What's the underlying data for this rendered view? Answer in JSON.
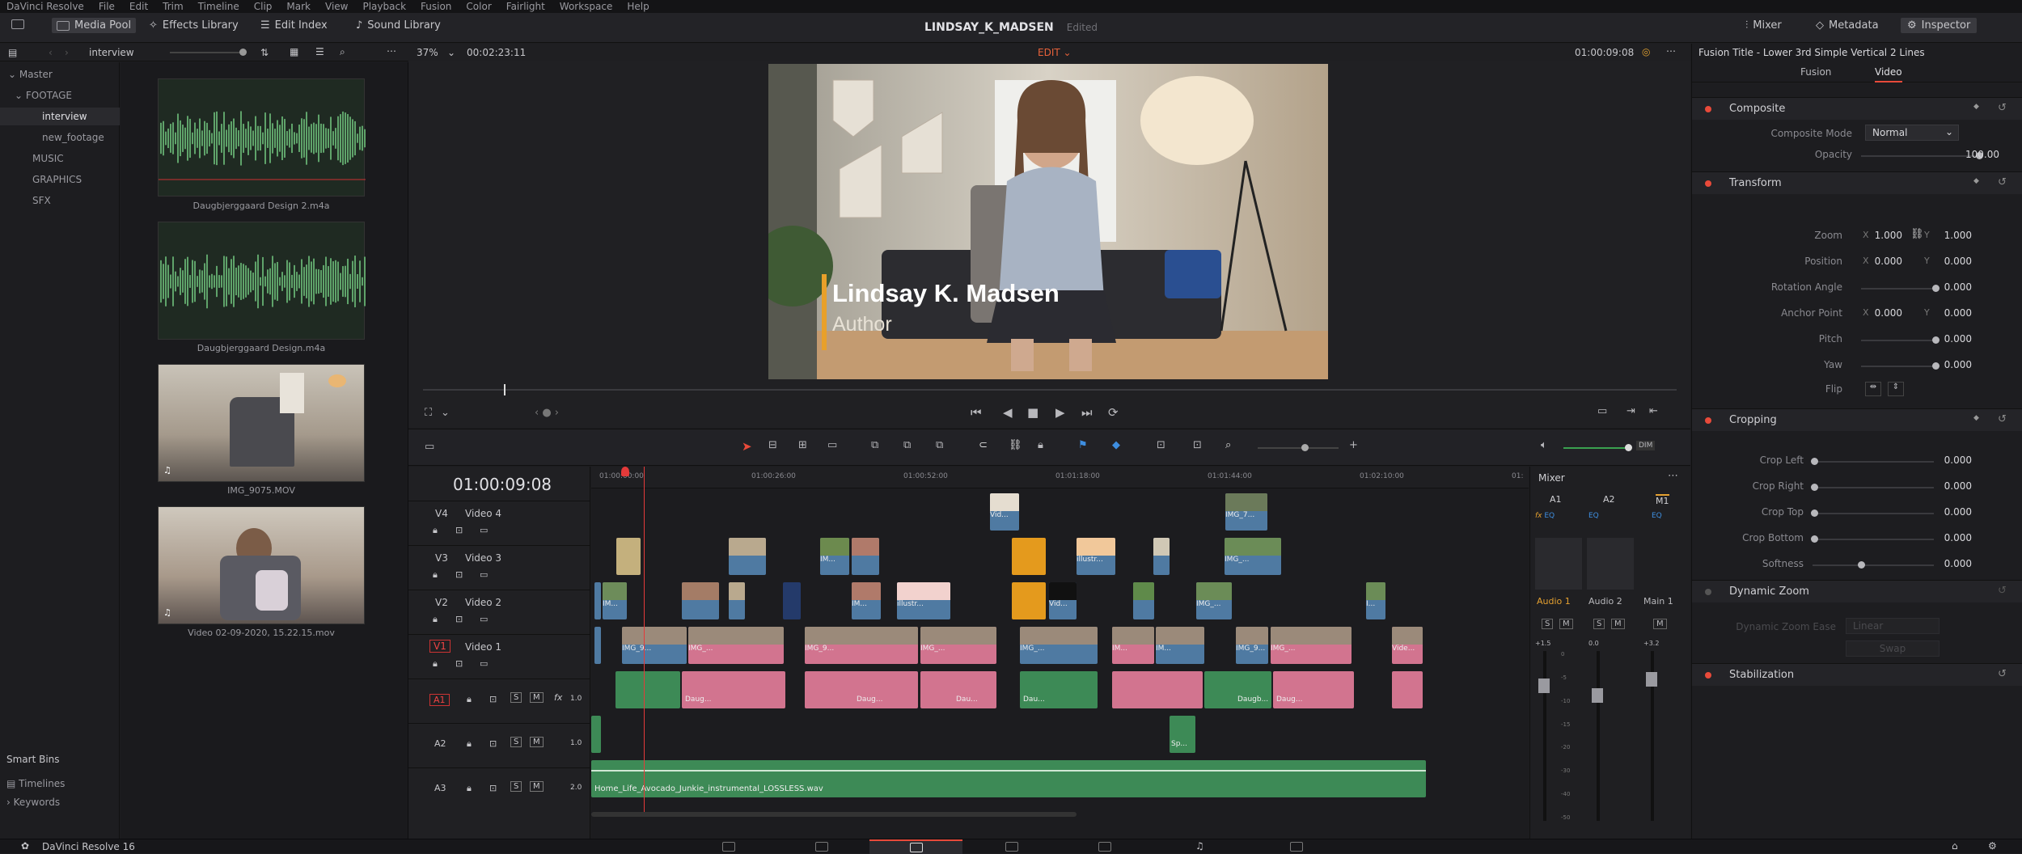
{
  "menu": [
    "DaVinci Resolve",
    "File",
    "Edit",
    "Trim",
    "Timeline",
    "Clip",
    "Mark",
    "View",
    "Playback",
    "Fusion",
    "Color",
    "Fairlight",
    "Workspace",
    "Help"
  ],
  "toolbar": {
    "media_pool": "Media Pool",
    "effects_library": "Effects Library",
    "edit_index": "Edit Index",
    "sound_library": "Sound Library",
    "project_title": "LINDSAY_K_MADSEN",
    "project_status": "Edited",
    "mixer": "Mixer",
    "metadata": "Metadata",
    "inspector": "Inspector"
  },
  "media_pool": {
    "current_bin": "interview",
    "bins": [
      {
        "label": "Master"
      },
      {
        "label": "FOOTAGE"
      },
      {
        "label": "interview"
      },
      {
        "label": "new_footage"
      },
      {
        "label": "MUSIC"
      },
      {
        "label": "GRAPHICS"
      },
      {
        "label": "SFX"
      }
    ],
    "clips": [
      {
        "name": "Daugbjerggaard Design 2.m4a",
        "kind": "audio"
      },
      {
        "name": "Daugbjerggaard Design.m4a",
        "kind": "audio"
      },
      {
        "name": "IMG_9075.MOV",
        "kind": "video"
      },
      {
        "name": "Video 02-09-2020, 15.22.15.mov",
        "kind": "video"
      }
    ],
    "smart_bins": "Smart Bins",
    "smart_items": [
      "Timelines",
      "Keywords"
    ]
  },
  "viewer": {
    "zoom": "37%",
    "source_timecode": "00:02:23:11",
    "mode": "EDIT",
    "record_timecode": "01:00:09:08",
    "lower_third_name": "Lindsay K. Madsen",
    "lower_third_title": "Author"
  },
  "timeline": {
    "timecode": "01:00:09:08",
    "ruler": [
      "01:00:00:00",
      "01:00:26:00",
      "01:00:52:00",
      "01:01:18:00",
      "01:01:44:00",
      "01:02:10:00",
      "01:"
    ],
    "tracks": [
      {
        "id": "V4",
        "name": "Video 4"
      },
      {
        "id": "V3",
        "name": "Video 3"
      },
      {
        "id": "V2",
        "name": "Video 2"
      },
      {
        "id": "V1",
        "name": "Video 1"
      },
      {
        "id": "A1",
        "name": "",
        "gain": "1.0"
      },
      {
        "id": "A2",
        "name": "",
        "gain": "1.0"
      },
      {
        "id": "A3",
        "name": "",
        "gain": "2.0"
      }
    ],
    "clip_labels": {
      "v4a": "Vid...",
      "v4b": "IMG_7...",
      "v3a": "IM...",
      "v3b": "illustr...",
      "v3c": "IMG_...",
      "v2a": "IM...",
      "v2b": "IM...",
      "v2c": "illustr...",
      "v2d": "Vid...",
      "v2e": "IMG_...",
      "v2f": "I...",
      "v1a": "IMG_9...",
      "v1b": "IMG_...",
      "v1c": "IMG_9...",
      "v1d": "IMG_...",
      "v1e": "IMG_...",
      "v1f": "IM...",
      "v1g": "IM...",
      "v1h": "IMG_9...",
      "v1i": "IMG_...",
      "v1j": "Vide...",
      "a1a": "Daug...",
      "a1b": "Daug...",
      "a1c": "Dau...",
      "a1d": "Dau...",
      "a1e": "Daugb...",
      "a1f": "Daug...",
      "a2a": "Sp...",
      "music": "Home_Life_Avocado_Junkie_instrumental_LOSSLESS.wav"
    }
  },
  "mixer": {
    "title": "Mixer",
    "channels": [
      "A1",
      "A2",
      "M1"
    ],
    "strips": [
      "Audio 1",
      "Audio 2",
      "Main 1"
    ],
    "levels": [
      "+1.5",
      "0.0",
      "+3.2"
    ],
    "scale": [
      "0",
      "-5",
      "-10",
      "-15",
      "-20",
      "-30",
      "-40",
      "-50"
    ]
  },
  "inspector": {
    "title": "Fusion Title - Lower 3rd Simple Vertical 2 Lines",
    "tabs": [
      "Fusion",
      "Video"
    ],
    "composite": {
      "header": "Composite",
      "mode_label": "Composite Mode",
      "mode": "Normal",
      "opacity_label": "Opacity",
      "opacity": "100.00"
    },
    "transform": {
      "header": "Transform",
      "zoom_label": "Zoom",
      "zoom_x": "1.000",
      "zoom_y": "1.000",
      "position_label": "Position",
      "pos_x": "0.000",
      "pos_y": "0.000",
      "rotation_label": "Rotation Angle",
      "rotation": "0.000",
      "anchor_label": "Anchor Point",
      "anchor_x": "0.000",
      "anchor_y": "0.000",
      "pitch_label": "Pitch",
      "pitch": "0.000",
      "yaw_label": "Yaw",
      "yaw": "0.000",
      "flip_label": "Flip"
    },
    "cropping": {
      "header": "Cropping",
      "left_label": "Crop Left",
      "left": "0.000",
      "right_label": "Crop Right",
      "right": "0.000",
      "top_label": "Crop Top",
      "top": "0.000",
      "bottom_label": "Crop Bottom",
      "bottom": "0.000",
      "soft_label": "Softness",
      "soft": "0.000"
    },
    "dynamic_zoom": {
      "header": "Dynamic Zoom",
      "ease_label": "Dynamic Zoom Ease",
      "ease": "Linear",
      "swap": "Swap"
    },
    "stabilization": {
      "header": "Stabilization"
    }
  },
  "status": {
    "app": "DaVinci Resolve 16"
  }
}
